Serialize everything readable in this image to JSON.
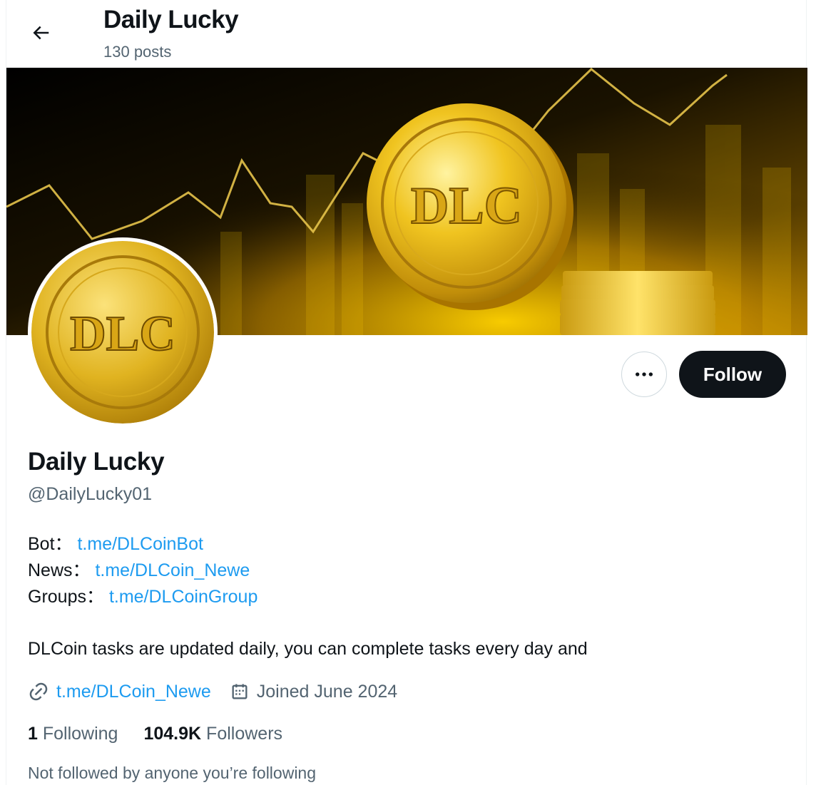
{
  "header": {
    "title": "Daily Lucky",
    "post_count": "130 posts"
  },
  "banner": {
    "coin_text": "DLC"
  },
  "avatar": {
    "coin_text": "DLC"
  },
  "actions": {
    "follow_label": "Follow"
  },
  "profile": {
    "name": "Daily Lucky",
    "handle": "@DailyLucky01",
    "bio_lines": [
      {
        "label": "Bot：",
        "link": "t.me/DLCoinBot"
      },
      {
        "label": "News：",
        "link": "t.me/DLCoin_Newe"
      },
      {
        "label": "Groups：",
        "link": "t.me/DLCoinGroup"
      }
    ],
    "description": "DLCoin tasks are updated daily, you can complete tasks every day and",
    "website": "t.me/DLCoin_Newe",
    "joined": "Joined June 2024",
    "following_count": "1",
    "following_label": "Following",
    "followers_count": "104.9K",
    "followers_label": "Followers",
    "not_followed_text": "Not followed by anyone you’re following"
  },
  "icons": {
    "back": "arrow-left-icon",
    "more": "more-dots-icon",
    "link": "link-icon",
    "calendar": "calendar-icon"
  },
  "colors": {
    "link": "#1d9bf0",
    "button_dark": "#0f1419",
    "muted": "#536471",
    "gold": "#e8b923"
  }
}
